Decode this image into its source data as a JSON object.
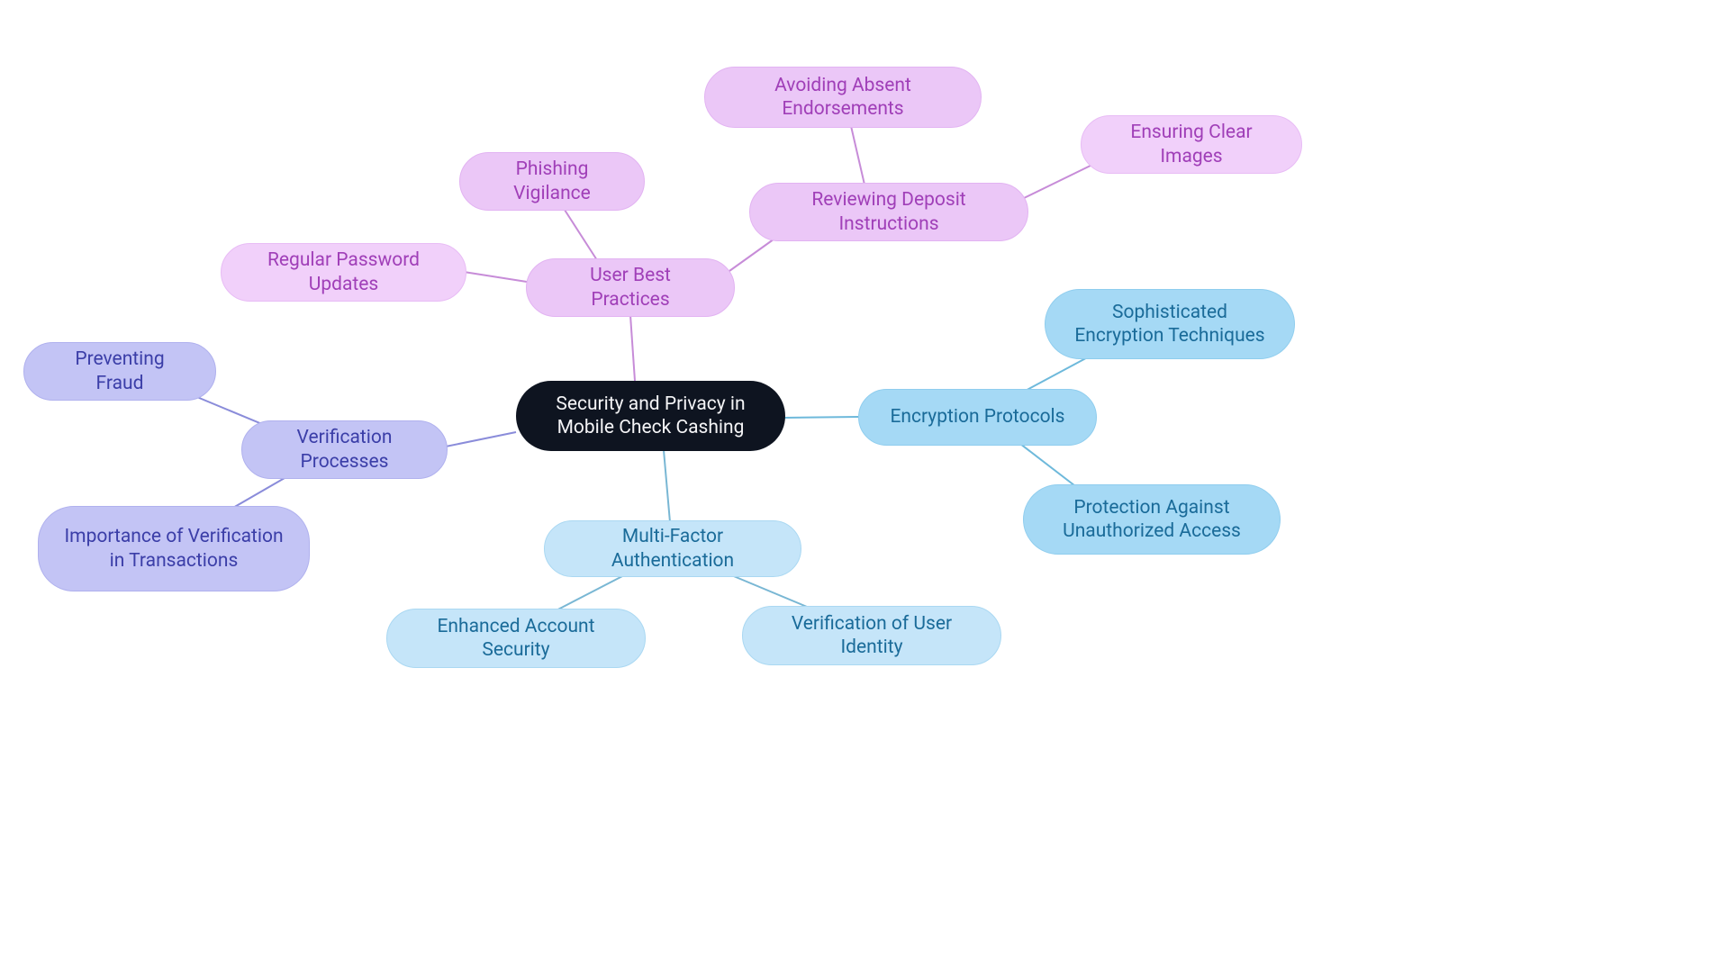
{
  "center": {
    "label": "Security and Privacy in Mobile Check Cashing"
  },
  "branches": [
    {
      "id": "encryption-protocols",
      "label": "Encryption Protocols",
      "color": "#a5d9f5",
      "children": [
        {
          "id": "sophisticated-encryption",
          "label": "Sophisticated Encryption Techniques"
        },
        {
          "id": "protection-unauthorized",
          "label": "Protection Against Unauthorized Access"
        }
      ]
    },
    {
      "id": "mfa",
      "label": "Multi-Factor Authentication",
      "color": "#c5e5f9",
      "children": [
        {
          "id": "enhanced-security",
          "label": "Enhanced Account Security"
        },
        {
          "id": "verification-identity",
          "label": "Verification of User Identity"
        }
      ]
    },
    {
      "id": "verification-processes",
      "label": "Verification Processes",
      "color": "#c3c4f5",
      "children": [
        {
          "id": "preventing-fraud",
          "label": "Preventing Fraud"
        },
        {
          "id": "importance-verification",
          "label": "Importance of Verification in Transactions"
        }
      ]
    },
    {
      "id": "user-best-practices",
      "label": "User Best Practices",
      "color": "#ebc7f7",
      "children": [
        {
          "id": "phishing-vigilance",
          "label": "Phishing Vigilance"
        },
        {
          "id": "password-updates",
          "label": "Regular Password Updates"
        },
        {
          "id": "reviewing-deposit",
          "label": "Reviewing Deposit Instructions",
          "children": [
            {
              "id": "avoiding-endorsements",
              "label": "Avoiding Absent Endorsements"
            },
            {
              "id": "ensuring-clear-images",
              "label": "Ensuring Clear Images"
            }
          ]
        }
      ]
    }
  ]
}
